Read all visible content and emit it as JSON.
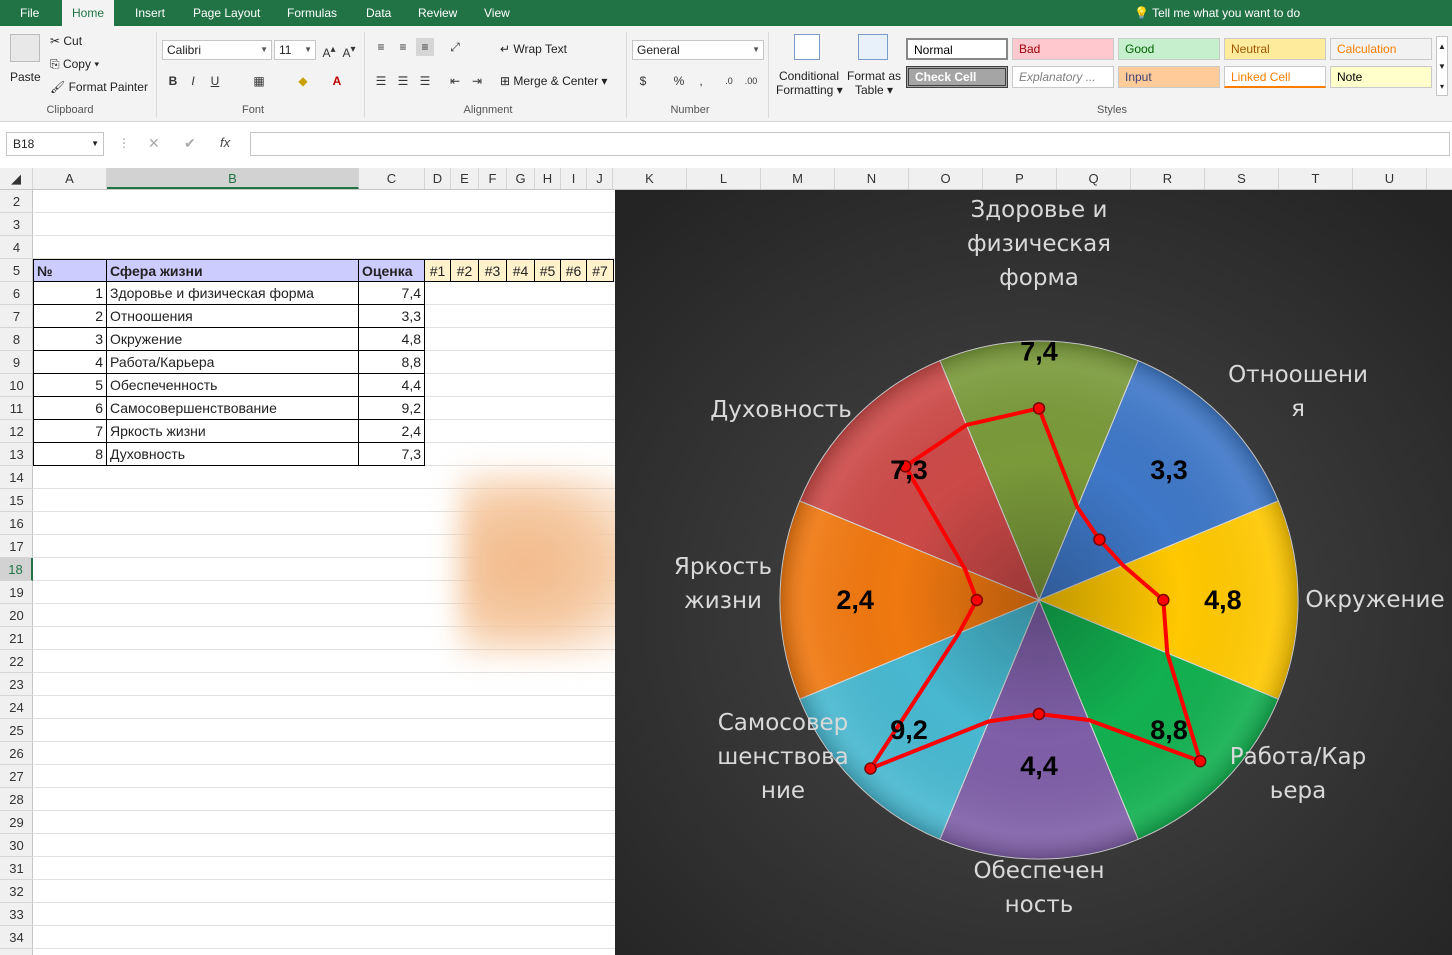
{
  "ribbon_tabs": [
    "File",
    "Home",
    "Insert",
    "Page Layout",
    "Formulas",
    "Data",
    "Review",
    "View"
  ],
  "active_tab": "Home",
  "tell_me": "Tell me what you want to do",
  "clipboard": {
    "paste": "Paste",
    "cut": "Cut",
    "copy": "Copy",
    "format_painter": "Format Painter",
    "label": "Clipboard"
  },
  "font": {
    "name": "Calibri",
    "size": "11",
    "label": "Font"
  },
  "alignment": {
    "wrap": "Wrap Text",
    "merge": "Merge & Center",
    "label": "Alignment"
  },
  "number": {
    "format": "General",
    "label": "Number"
  },
  "styles_group": {
    "conditional": "Conditional",
    "conditional2": "Formatting",
    "format_as": "Format as",
    "format_as2": "Table",
    "label": "Styles"
  },
  "styles": [
    {
      "name": "Normal",
      "bg": "#ffffff",
      "fg": "#000000"
    },
    {
      "name": "Bad",
      "bg": "#ffc7ce",
      "fg": "#9c0006"
    },
    {
      "name": "Good",
      "bg": "#c6efce",
      "fg": "#006100"
    },
    {
      "name": "Neutral",
      "bg": "#ffeb9c",
      "fg": "#9c5700"
    },
    {
      "name": "Calculation",
      "bg": "#f2f2f2",
      "fg": "#fa7d00"
    },
    {
      "name": "Check Cell",
      "bg": "#a5a5a5",
      "fg": "#ffffff"
    },
    {
      "name": "Explanatory ...",
      "bg": "#ffffff",
      "fg": "#7f7f7f"
    },
    {
      "name": "Input",
      "bg": "#ffcc99",
      "fg": "#3f3f76"
    },
    {
      "name": "Linked Cell",
      "bg": "#ffffff",
      "fg": "#fa7d00"
    },
    {
      "name": "Note",
      "bg": "#ffffcc",
      "fg": "#000000"
    }
  ],
  "name_box": "B18",
  "fx": "fx",
  "columns": [
    "A",
    "B",
    "C",
    "D",
    "E",
    "F",
    "G",
    "H",
    "I",
    "J",
    "K",
    "L",
    "M",
    "N",
    "O",
    "P",
    "Q",
    "R",
    "S",
    "T",
    "U"
  ],
  "rows": [
    "2",
    "3",
    "4",
    "5",
    "6",
    "7",
    "8",
    "9",
    "10",
    "11",
    "12",
    "13",
    "14",
    "15",
    "16",
    "17",
    "18",
    "19",
    "20",
    "21",
    "22",
    "23",
    "24",
    "25",
    "26",
    "27",
    "28",
    "29",
    "30",
    "31",
    "32",
    "33",
    "34"
  ],
  "selected_row": "18",
  "table": {
    "headers": [
      "№",
      "Сфера жизни",
      "Оценка"
    ],
    "extra_headers": [
      "#1",
      "#2",
      "#3",
      "#4",
      "#5",
      "#6",
      "#7"
    ],
    "rows": [
      {
        "n": "1",
        "sphere": "Здоровье и физическая форма",
        "score": "7,4"
      },
      {
        "n": "2",
        "sphere": "Отноошения",
        "score": "3,3"
      },
      {
        "n": "3",
        "sphere": "Окружение",
        "score": "4,8"
      },
      {
        "n": "4",
        "sphere": "Работа/Карьера",
        "score": "8,8"
      },
      {
        "n": "5",
        "sphere": "Обеспеченность",
        "score": "4,4"
      },
      {
        "n": "6",
        "sphere": "Самосовершенствование",
        "score": "9,2"
      },
      {
        "n": "7",
        "sphere": "Яркость жизни",
        "score": "2,4"
      },
      {
        "n": "8",
        "sphere": "Духовность",
        "score": "7,3"
      }
    ]
  },
  "chart_data": {
    "type": "pie",
    "categories": [
      "Здоровье и физическая форма",
      "Отноошения",
      "Окружение",
      "Работа/Карьера",
      "Обеспеченность",
      "Самосовершенствование",
      "Яркость жизни",
      "Духовность"
    ],
    "category_labels": [
      [
        "Здоровье и",
        "физическая",
        "форма"
      ],
      [
        "Отноошени",
        "я"
      ],
      [
        "Окружение"
      ],
      [
        "Работа/Кар",
        "ьера"
      ],
      [
        "Обеспечен",
        "ность"
      ],
      [
        "Самосовер",
        "шенствова",
        "ние"
      ],
      [
        "Яркость",
        "жизни"
      ],
      [
        "Духовность"
      ]
    ],
    "values": [
      7.4,
      3.3,
      4.8,
      8.8,
      4.4,
      9.2,
      2.4,
      7.3
    ],
    "value_labels": [
      "7,4",
      "3,3",
      "4,8",
      "8,8",
      "4,4",
      "9,2",
      "2,4",
      "7,3"
    ],
    "slice_colors": [
      "#7a9a3a",
      "#3f78c8",
      "#ffc800",
      "#12b050",
      "#7f5fa8",
      "#48b8d0",
      "#f07810",
      "#cc4a48"
    ],
    "radar_series_color": "#ff0000",
    "radar_max": 10,
    "background": "#303030"
  }
}
